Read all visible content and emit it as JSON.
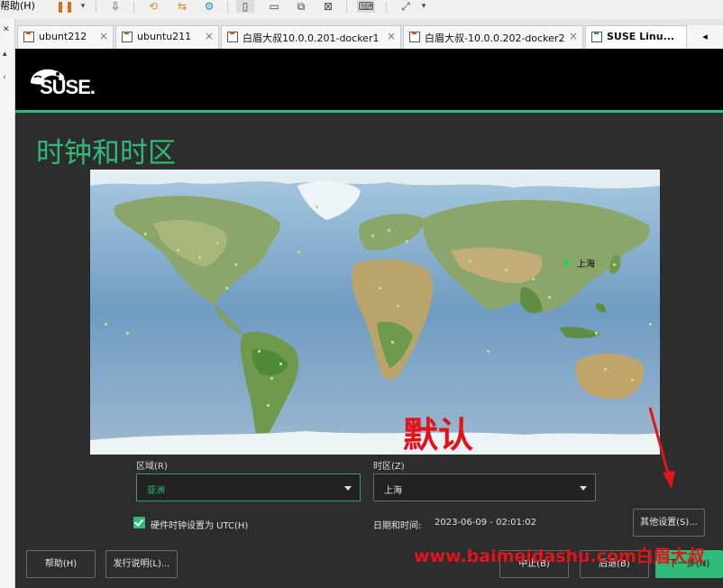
{
  "host": {
    "help_menu": "帮助(H)",
    "tabs": [
      {
        "label": "ubunt212",
        "active": false
      },
      {
        "label": "ubuntu211",
        "active": false
      },
      {
        "label": "白眉大叔10.0.0.201-docker1",
        "active": false
      },
      {
        "label": "白眉大叔-10.0.0.202-docker2",
        "active": false
      },
      {
        "label": "SUSE Linu...",
        "active": true
      }
    ],
    "tab_close": "×",
    "tab_scroll": "◂"
  },
  "installer": {
    "brand": "SUSE.",
    "title": "时钟和时区",
    "map_city": "上海",
    "region_label": "区域(R)",
    "region_value": "亚洲",
    "timezone_label": "时区(Z)",
    "timezone_value": "上海",
    "hw_clock_label": "硬件时钟设置为 UTC(H)",
    "hw_clock_checked": true,
    "datetime_label": "日期和时间:",
    "datetime_value": "2023-06-09 - 02:01:02",
    "other_settings": "其他设置(S)...",
    "buttons": {
      "help": "帮助(H)",
      "release_notes": "发行说明(L)...",
      "abort": "中止(B)",
      "back": "后退(B)",
      "next": "下一步(N)"
    }
  },
  "annotations": {
    "default_text": "默认",
    "watermark": "www.baimeidashu.com白眉大叔"
  },
  "colors": {
    "accent": "#30ba78",
    "annotation": "#e0141b"
  }
}
